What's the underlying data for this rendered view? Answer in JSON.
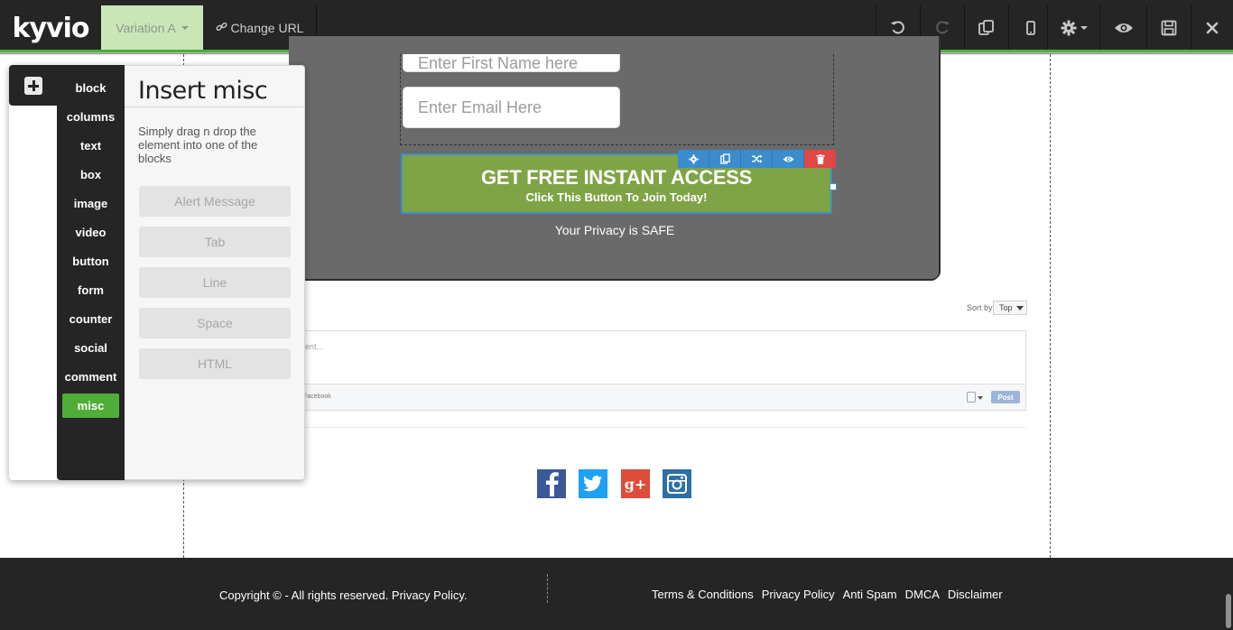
{
  "topbar": {
    "logo": "kyvio",
    "variation_label": "Variation A",
    "change_url_label": "Change URL"
  },
  "form": {
    "first_name_placeholder": "Enter First Name here",
    "email_placeholder": "Enter Email Here",
    "cta_main": "GET FREE INSTANT ACCESS",
    "cta_sub": "Click This Button To Join Today!",
    "privacy": "Your Privacy is SAFE"
  },
  "comments": {
    "sort_label": "Sort by",
    "sort_value": "Top",
    "input_placeholder": "ent...",
    "facebook_label": "Facebook",
    "post_label": "Post"
  },
  "footer": {
    "copyright": "Copyright © - All rights reserved. Privacy Policy.",
    "links": [
      "Terms & Conditions",
      "Privacy Policy",
      "Anti Spam",
      "DMCA",
      "Disclaimer"
    ]
  },
  "panel": {
    "title": "Insert misc",
    "description": "Simply drag n drop the element into one of the blocks",
    "categories": [
      "block",
      "columns",
      "text",
      "box",
      "image",
      "video",
      "button",
      "form",
      "counter",
      "social",
      "comment",
      "misc"
    ],
    "active_category": "misc",
    "items": [
      "Alert Message",
      "Tab",
      "Line",
      "Space",
      "HTML"
    ]
  },
  "social": {
    "google_plus_glyph": "g+",
    "icons": [
      "facebook-icon",
      "twitter-icon",
      "google-plus-icon",
      "instagram-icon"
    ]
  },
  "colors": {
    "accent_green": "#4fae38",
    "cta_green": "#7ea446",
    "toolbar_blue": "#3a8ccd",
    "delete_red": "#e04747",
    "dark_bar": "#252525"
  }
}
